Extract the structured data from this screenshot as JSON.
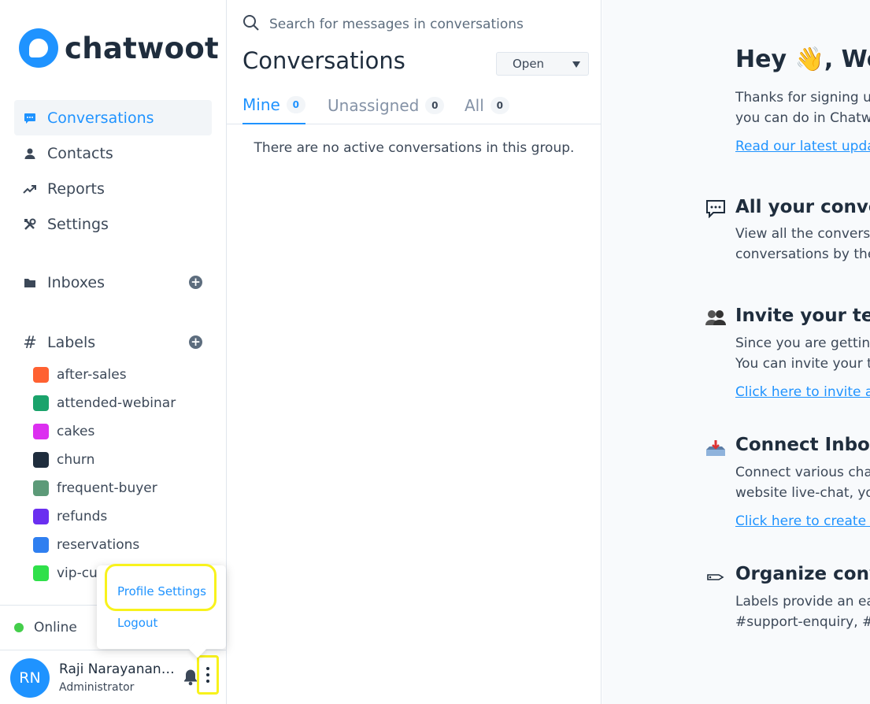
{
  "app": {
    "brand": "chatwoot",
    "accent_color": "#1f93ff"
  },
  "sidebar": {
    "nav": [
      {
        "label": "Conversations",
        "icon": "chat-bubble-icon",
        "active": true
      },
      {
        "label": "Contacts",
        "icon": "person-icon",
        "active": false
      },
      {
        "label": "Reports",
        "icon": "trending-up-icon",
        "active": false
      },
      {
        "label": "Settings",
        "icon": "tools-icon",
        "active": false
      }
    ],
    "inboxes_title": "Inboxes",
    "labels_title": "Labels",
    "labels": [
      {
        "name": "after-sales",
        "color": "#ff6131"
      },
      {
        "name": "attended-webinar",
        "color": "#1aa36b"
      },
      {
        "name": "cakes",
        "color": "#dc2ff0"
      },
      {
        "name": "churn",
        "color": "#1f2d3d"
      },
      {
        "name": "frequent-buyer",
        "color": "#5c9a78"
      },
      {
        "name": "refunds",
        "color": "#6a2ff0"
      },
      {
        "name": "reservations",
        "color": "#2f7ff0"
      },
      {
        "name": "vip-cu",
        "color": "#2fe04a"
      }
    ],
    "availability": "Online",
    "user": {
      "initials": "RN",
      "name": "Raji Narayanan ...",
      "role": "Administrator"
    },
    "menu": {
      "profile_settings": "Profile Settings",
      "logout": "Logout"
    }
  },
  "conversations": {
    "search_placeholder": "Search for messages in conversations",
    "title": "Conversations",
    "status_filter": "Open",
    "tabs": [
      {
        "label": "Mine",
        "count": "0",
        "active": true
      },
      {
        "label": "Unassigned",
        "count": "0",
        "active": false
      },
      {
        "label": "All",
        "count": "0",
        "active": false
      }
    ],
    "empty_message": "There are no active conversations in this group."
  },
  "welcome": {
    "greeting_prefix": "Hey ",
    "greeting_emoji": "👋",
    "greeting_suffix": ", Wel",
    "intro_line1": "Thanks for signing up",
    "intro_line2": "you can do in Chatw",
    "intro_link": "Read our latest upda",
    "sections": [
      {
        "icon": "chat-dots-icon",
        "title": "All your convers",
        "lines": [
          "View all the conversa",
          "conversations by the"
        ],
        "link": ""
      },
      {
        "icon": "team-icon",
        "title": "Invite your team",
        "lines": [
          "Since you are getting",
          "You can invite your t"
        ],
        "link": "Click here to invite a"
      },
      {
        "icon": "inbox-tray-icon",
        "title": "Connect Inboxe",
        "lines": [
          "Connect various cha",
          "website live-chat, yo"
        ],
        "link": "Click here to create a"
      },
      {
        "icon": "tag-icon",
        "title": "Organize conve",
        "lines": [
          "Labels provide an ea",
          "#support-enquiry, #"
        ],
        "link": ""
      }
    ]
  }
}
